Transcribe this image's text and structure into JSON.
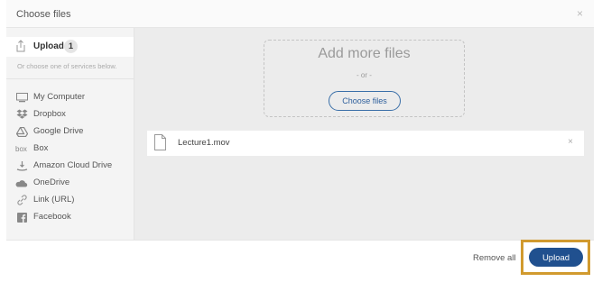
{
  "dialog": {
    "title": "Choose files",
    "close_icon": "close-icon",
    "close_glyph": "×"
  },
  "sidebar": {
    "upload": {
      "label": "Upload",
      "count": "1",
      "icon": "upload-icon"
    },
    "hint": "Or choose one of services below.",
    "services": [
      {
        "label": "My Computer",
        "icon": "monitor-icon"
      },
      {
        "label": "Dropbox",
        "icon": "dropbox-icon"
      },
      {
        "label": "Google Drive",
        "icon": "google-drive-icon"
      },
      {
        "label": "Box",
        "icon": "box-icon",
        "icon_text": "box"
      },
      {
        "label": "Amazon Cloud Drive",
        "icon": "amazon-cloud-drive-icon"
      },
      {
        "label": "OneDrive",
        "icon": "onedrive-icon"
      },
      {
        "label": "Link (URL)",
        "icon": "link-icon"
      },
      {
        "label": "Facebook",
        "icon": "facebook-icon"
      }
    ]
  },
  "dropzone": {
    "heading": "Add more files",
    "or_text": "- or -",
    "choose_label": "Choose files"
  },
  "files": [
    {
      "name": "Lecture1.mov",
      "icon": "file-icon",
      "remove_glyph": "×"
    }
  ],
  "footer": {
    "remove_all_label": "Remove all",
    "upload_label": "Upload"
  },
  "colors": {
    "accent": "#20508f",
    "highlight": "#d19a2e",
    "sidebar_bg": "#f4f4f4",
    "main_bg": "#ececec"
  }
}
